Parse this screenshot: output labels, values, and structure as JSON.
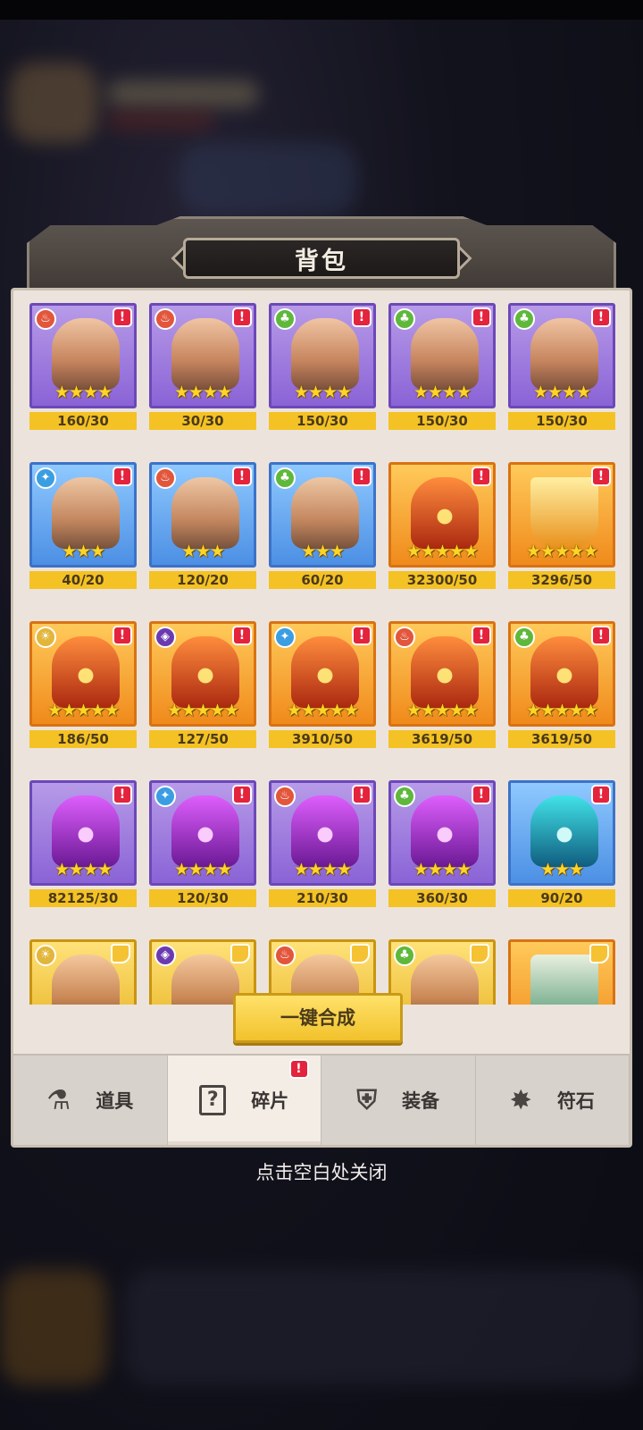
{
  "title": "背包",
  "items": [
    {
      "rarity": "purple",
      "art": "hero",
      "faction": "fire",
      "alert": "!",
      "stars": "★★★★",
      "count": "160/30"
    },
    {
      "rarity": "purple",
      "art": "hero",
      "faction": "fire",
      "alert": "!",
      "stars": "★★★★",
      "count": "30/30"
    },
    {
      "rarity": "purple",
      "art": "hero",
      "faction": "nature",
      "alert": "!",
      "stars": "★★★★",
      "count": "150/30"
    },
    {
      "rarity": "purple",
      "art": "hero",
      "faction": "nature",
      "alert": "!",
      "stars": "★★★★",
      "count": "150/30"
    },
    {
      "rarity": "purple",
      "art": "hero",
      "faction": "nature",
      "alert": "!",
      "stars": "★★★★",
      "count": "150/30"
    },
    {
      "rarity": "blue",
      "art": "hero",
      "faction": "water",
      "alert": "!",
      "stars": "★★★",
      "count": "40/20"
    },
    {
      "rarity": "blue",
      "art": "hero",
      "faction": "fire",
      "alert": "!",
      "stars": "★★★",
      "count": "120/20"
    },
    {
      "rarity": "blue",
      "art": "hero",
      "faction": "nature",
      "alert": "!",
      "stars": "★★★",
      "count": "60/20"
    },
    {
      "rarity": "orange",
      "art": "helm-orange",
      "faction": "",
      "alert": "!",
      "stars": "★★★★★",
      "count": "32300/50"
    },
    {
      "rarity": "orange",
      "art": "crown",
      "faction": "",
      "alert": "!",
      "stars": "★★★★★",
      "count": "3296/50"
    },
    {
      "rarity": "orange",
      "art": "helm-orange",
      "faction": "light",
      "alert": "!",
      "stars": "★★★★★",
      "count": "186/50"
    },
    {
      "rarity": "orange",
      "art": "helm-orange",
      "faction": "dark",
      "alert": "!",
      "stars": "★★★★★",
      "count": "127/50"
    },
    {
      "rarity": "orange",
      "art": "helm-orange",
      "faction": "water",
      "alert": "!",
      "stars": "★★★★★",
      "count": "3910/50"
    },
    {
      "rarity": "orange",
      "art": "helm-orange",
      "faction": "fire",
      "alert": "!",
      "stars": "★★★★★",
      "count": "3619/50"
    },
    {
      "rarity": "orange",
      "art": "helm-orange",
      "faction": "nature",
      "alert": "!",
      "stars": "★★★★★",
      "count": "3619/50"
    },
    {
      "rarity": "purple",
      "art": "helm-purple",
      "faction": "",
      "alert": "!",
      "stars": "★★★★",
      "count": "82125/30"
    },
    {
      "rarity": "purple",
      "art": "helm-purple",
      "faction": "water",
      "alert": "!",
      "stars": "★★★★",
      "count": "120/30"
    },
    {
      "rarity": "purple",
      "art": "helm-purple",
      "faction": "fire",
      "alert": "!",
      "stars": "★★★★",
      "count": "210/30"
    },
    {
      "rarity": "purple",
      "art": "helm-purple",
      "faction": "nature",
      "alert": "!",
      "stars": "★★★★",
      "count": "360/30"
    },
    {
      "rarity": "blue",
      "art": "helm-cyan",
      "faction": "",
      "alert": "!",
      "stars": "★★★",
      "count": "90/20"
    },
    {
      "rarity": "gold",
      "art": "hero",
      "faction": "light",
      "alert": "",
      "puzzle": true,
      "stars": "",
      "count": ""
    },
    {
      "rarity": "gold",
      "art": "hero",
      "faction": "dark",
      "alert": "",
      "puzzle": true,
      "stars": "",
      "count": ""
    },
    {
      "rarity": "gold",
      "art": "hero",
      "faction": "fire",
      "alert": "",
      "puzzle": true,
      "stars": "",
      "count": ""
    },
    {
      "rarity": "gold",
      "art": "hero",
      "faction": "nature",
      "alert": "",
      "puzzle": true,
      "stars": "",
      "count": ""
    },
    {
      "rarity": "orange",
      "art": "misc",
      "faction": "",
      "alert": "",
      "puzzle": true,
      "stars": "",
      "count": ""
    }
  ],
  "synthesize_button": "一键合成",
  "tabs": [
    {
      "label": "道具",
      "icon": "potion-icon",
      "glyph": "⚗",
      "active": false,
      "alert": ""
    },
    {
      "label": "碎片",
      "icon": "question-box-icon",
      "glyph": "?",
      "active": true,
      "alert": "!"
    },
    {
      "label": "装备",
      "icon": "shield-icon",
      "glyph": "⛨",
      "active": false,
      "alert": ""
    },
    {
      "label": "符石",
      "icon": "rune-star-icon",
      "glyph": "✸",
      "active": false,
      "alert": ""
    }
  ],
  "close_hint": "点击空白处关闭",
  "colors": {
    "accent": "#f4c224",
    "alert": "#e4233c",
    "panel": "#ece4dc"
  }
}
